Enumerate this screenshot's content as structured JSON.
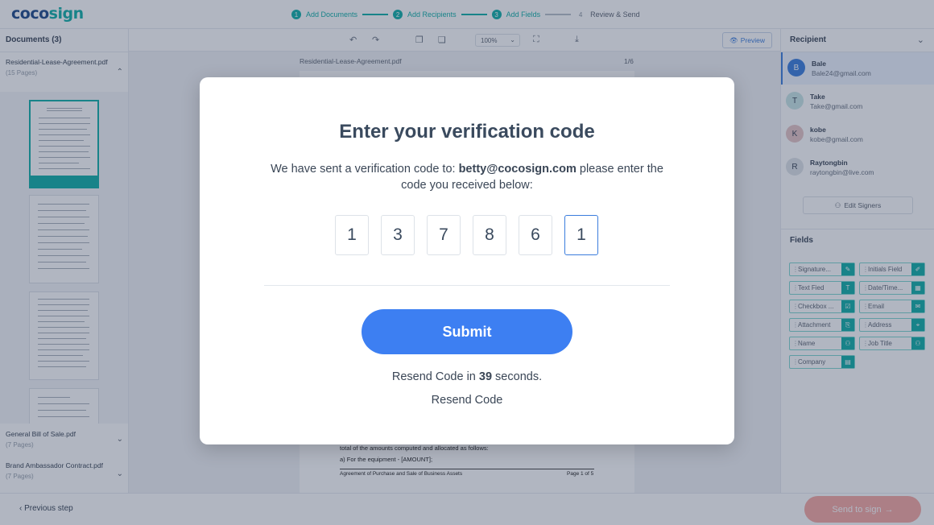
{
  "app": {
    "logo_part1": "coco",
    "logo_part2": "sign"
  },
  "stepper": [
    {
      "num": "1",
      "label": "Add Documents",
      "state": "done"
    },
    {
      "num": "2",
      "label": "Add Recipients",
      "state": "done"
    },
    {
      "num": "3",
      "label": "Add Fields",
      "state": "current"
    },
    {
      "num": "4",
      "label": "Review & Send",
      "state": "upcoming"
    }
  ],
  "documents": {
    "header": "Documents (3)",
    "items": [
      {
        "name": "Residential-Lease-Agreement.pdf",
        "pages": "(15 Pages)"
      },
      {
        "name": "General Bill of Sale.pdf",
        "pages": "(7 Pages)"
      },
      {
        "name": "Brand Ambassador Contract.pdf",
        "pages": "(7 Pages)"
      }
    ]
  },
  "viewer": {
    "zoom": "100%",
    "preview_label": "Preview",
    "doc_name": "Residential-Lease-Agreement.pdf",
    "page_indicator": "1/6",
    "visible_text": [
      "total of the amounts computed and allocated as follows:",
      "a)   For the equipment - [AMOUNT];"
    ],
    "footer_left": "Agreement of Purchase and Sale of Business Assets",
    "footer_right": "Page 1 of 5"
  },
  "recipients": {
    "header": "Recipient",
    "items": [
      {
        "initial": "B",
        "name": "Bale",
        "email": "Bale24@gmail.com",
        "color": "#3b7ddd"
      },
      {
        "initial": "T",
        "name": "Take",
        "email": "Take@gmail.com",
        "color": "#c8e6e6"
      },
      {
        "initial": "K",
        "name": "kobe",
        "email": "kobe@gmail.com",
        "color": "#e7c5c5"
      },
      {
        "initial": "R",
        "name": "Raytongbin",
        "email": "raytongbin@live.com",
        "color": "#dfe3e8"
      }
    ],
    "edit_signers": "Edit Signers"
  },
  "fields": {
    "header": "Fields",
    "items": [
      {
        "label": "Signature...",
        "icon": "signature-icon"
      },
      {
        "label": "Initials Field",
        "icon": "initials-icon"
      },
      {
        "label": "Text Fied",
        "icon": "text-icon"
      },
      {
        "label": "Date/Time...",
        "icon": "calendar-icon"
      },
      {
        "label": "Checkbox ...",
        "icon": "checkbox-icon"
      },
      {
        "label": "Email",
        "icon": "email-icon"
      },
      {
        "label": "Attachment",
        "icon": "attachment-icon"
      },
      {
        "label": "Address",
        "icon": "address-pin-icon"
      },
      {
        "label": "Name",
        "icon": "person-icon"
      },
      {
        "label": "Job Title",
        "icon": "job-title-icon"
      },
      {
        "label": "Company",
        "icon": "company-icon"
      }
    ]
  },
  "footer": {
    "prev_step": "Previous step",
    "send": "Send to sign"
  },
  "modal": {
    "title": "Enter your verification code",
    "desc_prefix": "We have sent a verification code to: ",
    "email": "betty@cocosign.com",
    "desc_suffix": " please enter the code you received below:",
    "code_digits": [
      "1",
      "3",
      "7",
      "8",
      "6",
      "1"
    ],
    "submit": "Submit",
    "resend_prefix": "Resend Code in ",
    "resend_seconds": "39",
    "resend_suffix": " seconds.",
    "resend_link": "Resend Code"
  },
  "colors": {
    "accent_teal": "#11b0a8",
    "primary_blue": "#3d7ff2",
    "send_button": "#f7a9a3",
    "overlay": "rgba(38,54,82,0.36)"
  }
}
